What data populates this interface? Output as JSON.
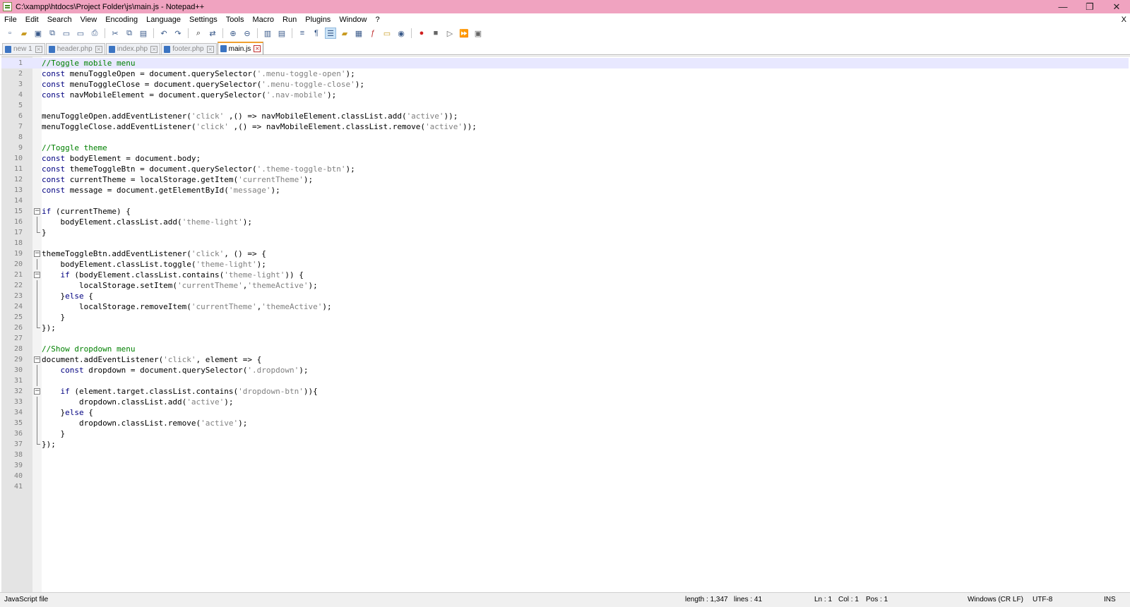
{
  "window": {
    "title": "C:\\xampp\\htdocs\\Project Folder\\js\\main.js - Notepad++",
    "controls": {
      "minimize": "—",
      "maximize": "❐",
      "close": "✕"
    }
  },
  "menubar": {
    "items": [
      "File",
      "Edit",
      "Search",
      "View",
      "Encoding",
      "Language",
      "Settings",
      "Tools",
      "Macro",
      "Run",
      "Plugins",
      "Window",
      "?"
    ],
    "close": "X"
  },
  "toolbar": {
    "icons": [
      "new-file-icon",
      "open-file-icon",
      "save-icon",
      "save-all-icon",
      "close-icon",
      "close-all-icon",
      "print-icon",
      "cut-icon",
      "copy-icon",
      "paste-icon",
      "undo-icon",
      "redo-icon",
      "find-icon",
      "replace-icon",
      "zoom-in-icon",
      "zoom-out-icon",
      "sync-vertical-icon",
      "sync-horizontal-icon",
      "word-wrap-icon",
      "show-all-chars-icon",
      "indent-guide-icon",
      "user-language-icon",
      "document-map-icon",
      "function-list-icon",
      "folder-as-workspace-icon",
      "monitoring-icon",
      "macro-record-icon",
      "macro-stop-icon",
      "macro-play-icon",
      "macro-run-multiple-icon",
      "macro-save-icon"
    ]
  },
  "tabs": [
    {
      "label": "new 1",
      "active": false
    },
    {
      "label": "header.php",
      "active": false
    },
    {
      "label": "index.php",
      "active": false
    },
    {
      "label": "footer.php",
      "active": false
    },
    {
      "label": "main.js",
      "active": true
    }
  ],
  "editor": {
    "current_line": 1,
    "lines": [
      {
        "n": "1",
        "fold": "",
        "t": [
          [
            "cmt",
            "//Toggle mobile menu"
          ]
        ]
      },
      {
        "n": "2",
        "fold": "",
        "t": [
          [
            "kw",
            "const"
          ],
          [
            "",
            "menuToggleOpen = document.querySelector("
          ],
          [
            "str",
            "'.menu-toggle-open'"
          ],
          [
            "",
            ");"
          ]
        ]
      },
      {
        "n": "3",
        "fold": "",
        "t": [
          [
            "kw",
            "const"
          ],
          [
            "",
            "menuToggleClose = document.querySelector("
          ],
          [
            "str",
            "'.menu-toggle-close'"
          ],
          [
            "",
            ");"
          ]
        ]
      },
      {
        "n": "4",
        "fold": "",
        "t": [
          [
            "kw",
            "const"
          ],
          [
            "",
            "navMobileElement = document.querySelector("
          ],
          [
            "str",
            "'.nav-mobile'"
          ],
          [
            "",
            ");"
          ]
        ]
      },
      {
        "n": "5",
        "fold": "",
        "t": []
      },
      {
        "n": "6",
        "fold": "",
        "t": [
          [
            "",
            "menuToggleOpen.addEventListener("
          ],
          [
            "str",
            "'click'"
          ],
          [
            "",
            " ,() => navMobileElement.classList.add("
          ],
          [
            "str",
            "'active'"
          ],
          [
            "",
            "));"
          ]
        ]
      },
      {
        "n": "7",
        "fold": "",
        "t": [
          [
            "",
            "menuToggleClose.addEventListener("
          ],
          [
            "str",
            "'click'"
          ],
          [
            "",
            " ,() => navMobileElement.classList.remove("
          ],
          [
            "str",
            "'active'"
          ],
          [
            "",
            "));"
          ]
        ]
      },
      {
        "n": "8",
        "fold": "",
        "t": []
      },
      {
        "n": "9",
        "fold": "",
        "t": [
          [
            "cmt",
            "//Toggle theme"
          ]
        ]
      },
      {
        "n": "10",
        "fold": "",
        "t": [
          [
            "kw",
            "const"
          ],
          [
            "",
            "bodyElement = document.body;"
          ]
        ]
      },
      {
        "n": "11",
        "fold": "",
        "t": [
          [
            "kw",
            "const"
          ],
          [
            "",
            "themeToggleBtn = document.querySelector("
          ],
          [
            "str",
            "'.theme-toggle-btn'"
          ],
          [
            "",
            ");"
          ]
        ]
      },
      {
        "n": "12",
        "fold": "",
        "t": [
          [
            "kw",
            "const"
          ],
          [
            "",
            "currentTheme = localStorage.getItem("
          ],
          [
            "str",
            "'currentTheme'"
          ],
          [
            "",
            ");"
          ]
        ]
      },
      {
        "n": "13",
        "fold": "",
        "t": [
          [
            "kw",
            "const"
          ],
          [
            "",
            "message = document.getElementById("
          ],
          [
            "str",
            "'message'"
          ],
          [
            "",
            ");"
          ]
        ]
      },
      {
        "n": "14",
        "fold": "",
        "t": []
      },
      {
        "n": "15",
        "fold": "box",
        "t": [
          [
            "kw",
            "if"
          ],
          [
            "",
            " (currentTheme) {"
          ]
        ]
      },
      {
        "n": "16",
        "fold": "mid",
        "t": [
          [
            "",
            "    bodyElement.classList.add("
          ],
          [
            "str",
            "'theme-light'"
          ],
          [
            "",
            ");"
          ]
        ]
      },
      {
        "n": "17",
        "fold": "end",
        "t": [
          [
            "",
            "}"
          ]
        ]
      },
      {
        "n": "18",
        "fold": "",
        "t": []
      },
      {
        "n": "19",
        "fold": "box",
        "t": [
          [
            "",
            "themeToggleBtn.addEventListener("
          ],
          [
            "str",
            "'click'"
          ],
          [
            "",
            ", () => {"
          ]
        ]
      },
      {
        "n": "20",
        "fold": "mid",
        "t": [
          [
            "",
            "    bodyElement.classList.toggle("
          ],
          [
            "str",
            "'theme-light'"
          ],
          [
            "",
            ");"
          ]
        ]
      },
      {
        "n": "21",
        "fold": "box",
        "t": [
          [
            "",
            "    "
          ],
          [
            "kw",
            "if"
          ],
          [
            "",
            " (bodyElement.classList.contains("
          ],
          [
            "str",
            "'theme-light'"
          ],
          [
            "",
            ")) {"
          ]
        ]
      },
      {
        "n": "22",
        "fold": "mid",
        "t": [
          [
            "",
            "        localStorage.setItem("
          ],
          [
            "str",
            "'currentTheme'"
          ],
          [
            "",
            ","
          ],
          [
            "str",
            "'themeActive'"
          ],
          [
            "",
            ");"
          ]
        ]
      },
      {
        "n": "23",
        "fold": "mid",
        "t": [
          [
            "",
            "    }"
          ],
          [
            "kw",
            "else"
          ],
          [
            "",
            "{"
          ]
        ]
      },
      {
        "n": "24",
        "fold": "mid",
        "t": [
          [
            "",
            "        localStorage.removeItem("
          ],
          [
            "str",
            "'currentTheme'"
          ],
          [
            "",
            ","
          ],
          [
            "str",
            "'themeActive'"
          ],
          [
            "",
            ");"
          ]
        ]
      },
      {
        "n": "25",
        "fold": "mid",
        "t": [
          [
            "",
            "    }"
          ]
        ]
      },
      {
        "n": "26",
        "fold": "end",
        "t": [
          [
            "",
            "});"
          ]
        ]
      },
      {
        "n": "27",
        "fold": "",
        "t": []
      },
      {
        "n": "28",
        "fold": "",
        "t": [
          [
            "cmt",
            "//Show dropdown menu"
          ]
        ]
      },
      {
        "n": "29",
        "fold": "box",
        "t": [
          [
            "",
            "document.addEventListener("
          ],
          [
            "str",
            "'click'"
          ],
          [
            "",
            ", element => {"
          ]
        ]
      },
      {
        "n": "30",
        "fold": "mid",
        "t": [
          [
            "",
            "    "
          ],
          [
            "kw",
            "const"
          ],
          [
            "",
            " dropdown = document.querySelector("
          ],
          [
            "str",
            "'.dropdown'"
          ],
          [
            "",
            ");"
          ]
        ]
      },
      {
        "n": "31",
        "fold": "mid",
        "t": []
      },
      {
        "n": "32",
        "fold": "box",
        "t": [
          [
            "",
            "    "
          ],
          [
            "kw",
            "if"
          ],
          [
            "",
            "(element.target.classList.contains("
          ],
          [
            "str",
            "'dropdown-btn'"
          ],
          [
            "",
            ")){"
          ]
        ]
      },
      {
        "n": "33",
        "fold": "mid",
        "t": [
          [
            "",
            "        dropdown.classList.add("
          ],
          [
            "str",
            "'active'"
          ],
          [
            "",
            ");"
          ]
        ]
      },
      {
        "n": "34",
        "fold": "mid",
        "t": [
          [
            "",
            "    }"
          ],
          [
            "kw",
            "else"
          ],
          [
            "",
            "{"
          ]
        ]
      },
      {
        "n": "35",
        "fold": "mid",
        "t": [
          [
            "",
            "        dropdown.classList.remove("
          ],
          [
            "str",
            "'active'"
          ],
          [
            "",
            ");"
          ]
        ]
      },
      {
        "n": "36",
        "fold": "mid",
        "t": [
          [
            "",
            "    }"
          ]
        ]
      },
      {
        "n": "37",
        "fold": "end",
        "t": [
          [
            "",
            "});"
          ]
        ]
      },
      {
        "n": "38",
        "fold": "",
        "t": []
      },
      {
        "n": "39",
        "fold": "",
        "t": []
      },
      {
        "n": "40",
        "fold": "",
        "t": []
      },
      {
        "n": "41",
        "fold": "",
        "t": []
      }
    ]
  },
  "statusbar": {
    "file_type": "JavaScript file",
    "length": "length : 1,347",
    "lines": "lines : 41",
    "ln": "Ln : 1",
    "col": "Col : 1",
    "pos": "Pos : 1",
    "eol": "Windows (CR LF)",
    "encoding": "UTF-8",
    "mode": "INS"
  }
}
